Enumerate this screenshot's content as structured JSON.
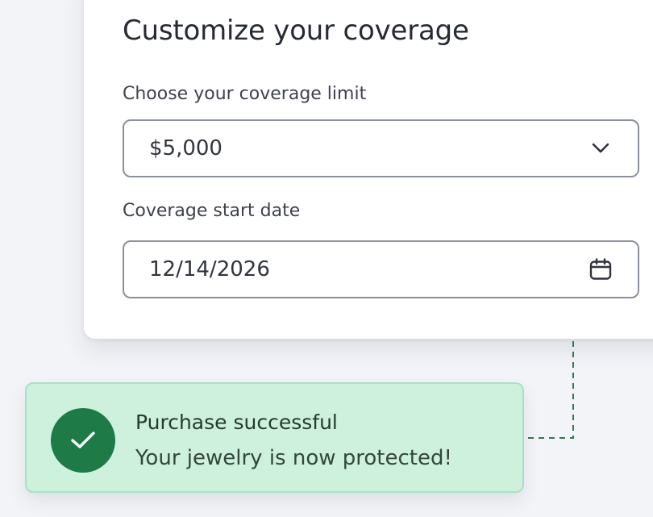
{
  "card": {
    "title": "Customize your coverage",
    "limit_field": {
      "label": "Choose your coverage limit",
      "value": "$5,000",
      "icon": "chevron-down-icon"
    },
    "date_field": {
      "label": "Coverage start date",
      "value": "12/14/2026",
      "icon": "calendar-icon"
    }
  },
  "toast": {
    "title": "Purchase successful",
    "message": "Your jewelry is now protected!",
    "icon": "check-icon",
    "status_color": "#1e7a47",
    "background_color": "#cdf1dc"
  }
}
